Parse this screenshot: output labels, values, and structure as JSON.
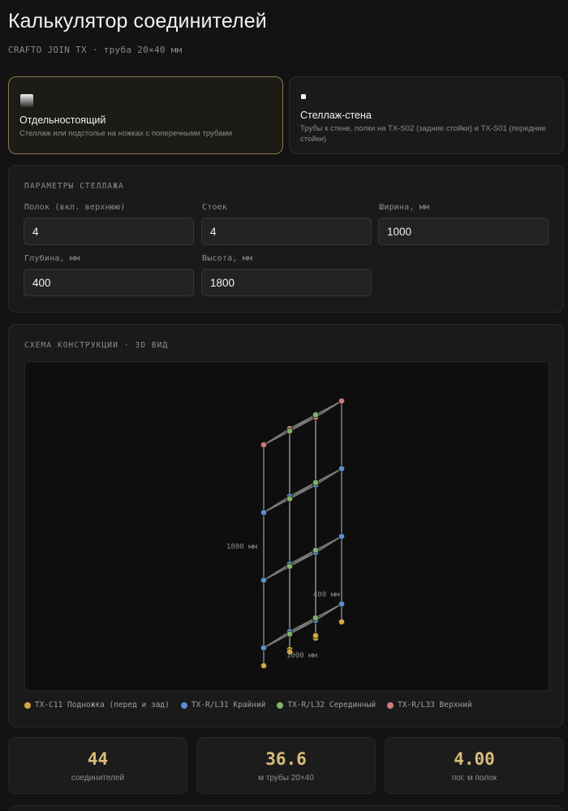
{
  "header": {
    "title": "Калькулятор соединителей",
    "subtitle": "CRAFTO JOIN TX · труба 20×40 мм"
  },
  "modes": [
    {
      "name": "Отдельностоящий",
      "description": "Стеллаж или подстолье на ножках с поперечными трубами",
      "selected": true
    },
    {
      "name": "Стеллаж-стена",
      "description": "Трубы к стене, полки на TX-S02 (задние стойки) и TX-S01 (передние стойки)",
      "selected": false
    }
  ],
  "params": {
    "title": "ПАРАМЕТРЫ СТЕЛЛАЖА",
    "fields": [
      {
        "label": "Полок (вкл. верхнюю)",
        "value": "4"
      },
      {
        "label": "Стоек",
        "value": "4"
      },
      {
        "label": "Ширина, мм",
        "value": "1000"
      },
      {
        "label": "Глубина, мм",
        "value": "400"
      },
      {
        "label": "Высота, мм",
        "value": "1800"
      }
    ]
  },
  "scheme": {
    "title": "СХЕМА КОНСТРУКЦИИ · 3D ВИД",
    "dim_height": "1800 мм",
    "dim_depth": "400 мм",
    "dim_width": "1000 мм",
    "colors": {
      "foot": "#d6a93c",
      "edge": "#5b8fd3",
      "middle": "#7fb36a",
      "top": "#d17a7c",
      "line": "#7a7a7a",
      "shelf_fill": "#3b3a2a"
    },
    "legend": [
      {
        "label": "TX-C11 Подножка (перед и зад)",
        "color": "#d6a93c"
      },
      {
        "label": "TX-R/L31 Крайний",
        "color": "#5b8fd3"
      },
      {
        "label": "TX-R/L32 Серединный",
        "color": "#7fb36a"
      },
      {
        "label": "TX-R/L33 Верхний",
        "color": "#d17a7c"
      }
    ]
  },
  "stats": [
    {
      "value": "44",
      "label": "соединителей"
    },
    {
      "value": "36.6",
      "label": "м трубы 20×40"
    },
    {
      "value": "4.00",
      "label": "пог. м полок"
    }
  ]
}
